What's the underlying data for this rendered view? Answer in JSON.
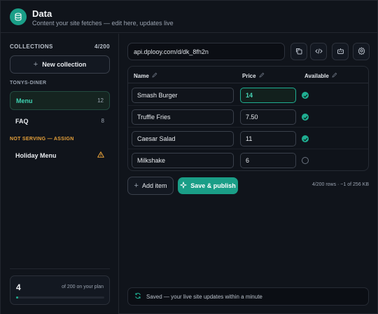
{
  "header": {
    "title": "Data",
    "subtitle": "Content your site fetches — edit here, updates live"
  },
  "sidebar": {
    "collections_label": "COLLECTIONS",
    "collections_count": "4/200",
    "new_collection_label": "New collection",
    "group_label": "TONYS-DINER",
    "items": [
      {
        "label": "Menu",
        "count": "12"
      },
      {
        "label": "FAQ",
        "count": "8"
      }
    ],
    "not_serving_label": "NOT SERVING — ASSIGN",
    "holiday_label": "Holiday Menu",
    "plan_count": "4",
    "plan_text": "of 200 on your plan",
    "plan_fraction": 0.02
  },
  "main": {
    "endpoint": "api.dplooy.com/d/dk_8fh2n",
    "columns": {
      "name": "Name",
      "price": "Price",
      "available": "Available"
    },
    "rows": [
      {
        "name": "Smash Burger",
        "price": "14",
        "available": true
      },
      {
        "name": "Truffle Fries",
        "price": "7.50",
        "available": true
      },
      {
        "name": "Caesar Salad",
        "price": "11",
        "available": true
      },
      {
        "name": "Milkshake",
        "price": "6",
        "available": false
      }
    ],
    "add_item_label": "Add item",
    "publish_label": "Save & publish",
    "rows_info": "4/200 rows · ~1 of 256 KB",
    "status_text": "Saved — your live site updates within a minute"
  },
  "colors": {
    "accent": "#1a9e87",
    "accent_text": "#3fd4b3",
    "warning": "#e8a23a",
    "background": "#10141b"
  },
  "icons": [
    "database-icon",
    "copy-icon",
    "code-icon",
    "robot-icon",
    "gear-icon",
    "pencil-icon",
    "plus-icon",
    "warning-icon",
    "sparkle-icon",
    "refresh-icon",
    "check-icon"
  ]
}
